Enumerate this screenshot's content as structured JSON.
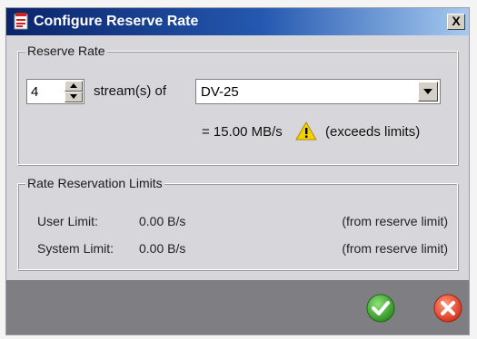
{
  "window": {
    "title": "Configure Reserve Rate",
    "close_label": "X"
  },
  "reserve_rate": {
    "legend": "Reserve Rate",
    "stream_count": "4",
    "streams_label": "stream(s) of",
    "format_selected": "DV-25",
    "rate_text": "= 15.00 MB/s",
    "warning_text": "(exceeds limits)",
    "warning_icon": "warning-triangle-icon"
  },
  "limits": {
    "legend": "Rate Reservation Limits",
    "rows": [
      {
        "label": "User Limit:",
        "value": "0.00 B/s",
        "source": "(from reserve limit)"
      },
      {
        "label": "System Limit:",
        "value": "0.00 B/s",
        "source": "(from reserve limit)"
      }
    ]
  },
  "buttons": {
    "ok_icon": "checkmark-icon",
    "cancel_icon": "cancel-x-icon",
    "ok_color": "#3aa52a",
    "cancel_color": "#e0442a"
  },
  "colors": {
    "title_bar": "#0a246a",
    "dialog_bg": "#d7d7db",
    "footer_bg": "#7f7f83",
    "warning": "#f5d000"
  }
}
